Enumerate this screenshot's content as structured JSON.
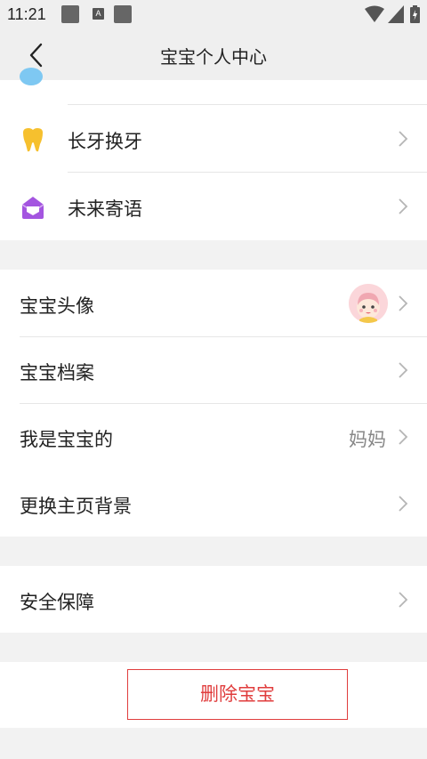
{
  "status_bar": {
    "time": "11:21",
    "notif_a": "A"
  },
  "nav": {
    "title": "宝宝个人中心",
    "back_icon": "chevron-left-icon"
  },
  "section_top": {
    "items": [
      {
        "label": "长牙换牙",
        "icon": "tooth-icon"
      },
      {
        "label": "未来寄语",
        "icon": "envelope-icon"
      }
    ]
  },
  "section_profile": {
    "items": [
      {
        "label": "宝宝头像",
        "value": ""
      },
      {
        "label": "宝宝档案",
        "value": ""
      },
      {
        "label": "我是宝宝的",
        "value": "妈妈"
      },
      {
        "label": "更换主页背景",
        "value": ""
      }
    ]
  },
  "section_safety": {
    "items": [
      {
        "label": "安全保障"
      }
    ]
  },
  "delete": {
    "label": "删除宝宝"
  },
  "colors": {
    "accent_red": "#e03d3d",
    "tooth_yellow": "#f6c02e",
    "envelope_purple": "#a455e0",
    "background": "#f2f2f2"
  }
}
